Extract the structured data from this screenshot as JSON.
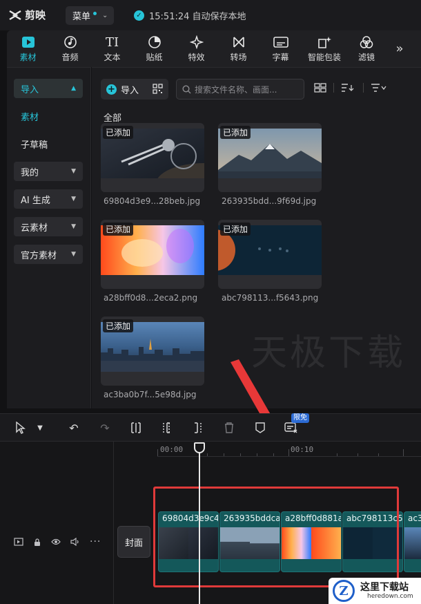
{
  "app": {
    "logo_text": "剪映",
    "menu_label": "菜单",
    "save_status": "15:51:24 自动保存本地"
  },
  "toolbar": {
    "tabs": [
      {
        "label": "素材",
        "icon": "media-play-icon"
      },
      {
        "label": "音频",
        "icon": "music-note-icon"
      },
      {
        "label": "文本",
        "icon": "text-icon"
      },
      {
        "label": "贴纸",
        "icon": "sticker-icon"
      },
      {
        "label": "特效",
        "icon": "sparkle-icon"
      },
      {
        "label": "转场",
        "icon": "transition-icon"
      },
      {
        "label": "字幕",
        "icon": "caption-icon"
      },
      {
        "label": "智能包装",
        "icon": "smart-pack-icon"
      },
      {
        "label": "滤镜",
        "icon": "filter-icon"
      }
    ],
    "more_glyph": "»"
  },
  "sidebar": {
    "items": [
      {
        "label": "导入"
      },
      {
        "label": "素材"
      },
      {
        "label": "子草稿"
      },
      {
        "label": "我的"
      },
      {
        "label": "AI 生成"
      },
      {
        "label": "云素材"
      },
      {
        "label": "官方素材"
      }
    ]
  },
  "media": {
    "import_label": "导入",
    "search_placeholder": "搜索文件名称、画面...",
    "section_label": "全部",
    "added_badge": "已添加",
    "items": [
      {
        "name": "69804d3e9...28beb.jpg"
      },
      {
        "name": "263935bdd...9f69d.jpg"
      },
      {
        "name": "a28bff0d8...2eca2.png"
      },
      {
        "name": "abc798113...f5643.png"
      },
      {
        "name": "ac3ba0b7f...5e98d.jpg"
      }
    ],
    "watermark": "天极下载"
  },
  "timeline": {
    "limit_badge": "限免",
    "ruler": [
      "00:00",
      "00:10"
    ],
    "cover_label": "封面",
    "clips": [
      {
        "title": "69804d3e9c4"
      },
      {
        "title": "263935bddca"
      },
      {
        "title": "a28bff0d881a"
      },
      {
        "title": "abc798113c5"
      },
      {
        "title": "ac3"
      }
    ]
  },
  "site_badge": {
    "name": "这里下载站",
    "domain": "heredown.com",
    "logo_letter": "Z"
  },
  "colors": {
    "accent": "#27c4d8",
    "highlight": "#e03a3a",
    "clip": "#14585a"
  }
}
